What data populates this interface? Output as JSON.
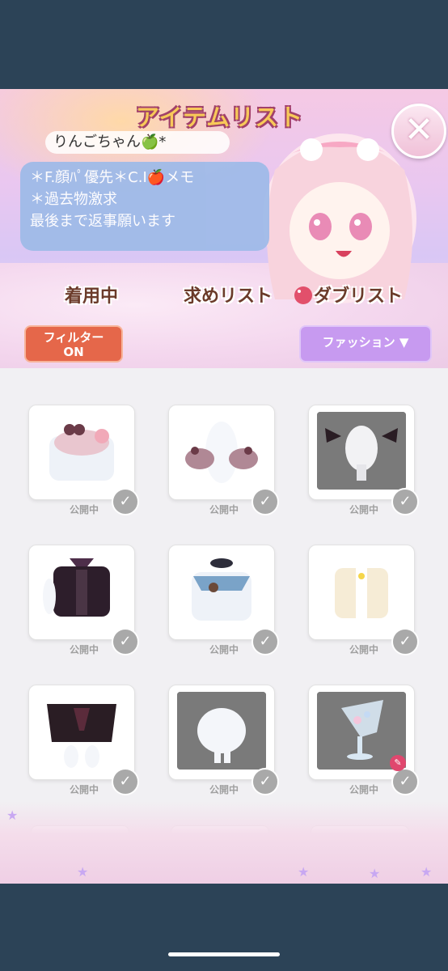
{
  "header": {
    "title": "アイテムリスト",
    "username": "りんごちゃん🍏*",
    "memo_lines": [
      "＊F.顔ﾊﾟ優先＊C.I🍎メモ",
      "＊過去物激求",
      "最後まで返事願います"
    ]
  },
  "tabs": [
    {
      "label": "着用中"
    },
    {
      "label": "求めリスト"
    },
    {
      "label": "ダブリスト"
    }
  ],
  "filter": {
    "line1": "フィルター",
    "line2": "ON"
  },
  "category": {
    "label": "ファッション ▼"
  },
  "items": [
    {
      "status": "公開中",
      "thumb": "pink-blouse",
      "dark": false
    },
    {
      "status": "公開中",
      "thumb": "bow-cuffs",
      "dark": false
    },
    {
      "status": "公開中",
      "thumb": "bat-wing-hair",
      "dark": true
    },
    {
      "status": "公開中",
      "thumb": "black-top",
      "dark": false
    },
    {
      "status": "公開中",
      "thumb": "sailor-top",
      "dark": false
    },
    {
      "status": "公開中",
      "thumb": "cream-vest",
      "dark": false
    },
    {
      "status": "公開中",
      "thumb": "black-skirt",
      "dark": false
    },
    {
      "status": "公開中",
      "thumb": "white-dress",
      "dark": true
    },
    {
      "status": "公開中",
      "thumb": "glass-goblet",
      "dark": true
    }
  ],
  "icons": {
    "close": "close-icon",
    "check": "check-icon",
    "edit": "pencil-badge-icon"
  },
  "colors": {
    "filter": "#e5674a",
    "category": "#c79af0",
    "check": "#a9a9a9"
  }
}
